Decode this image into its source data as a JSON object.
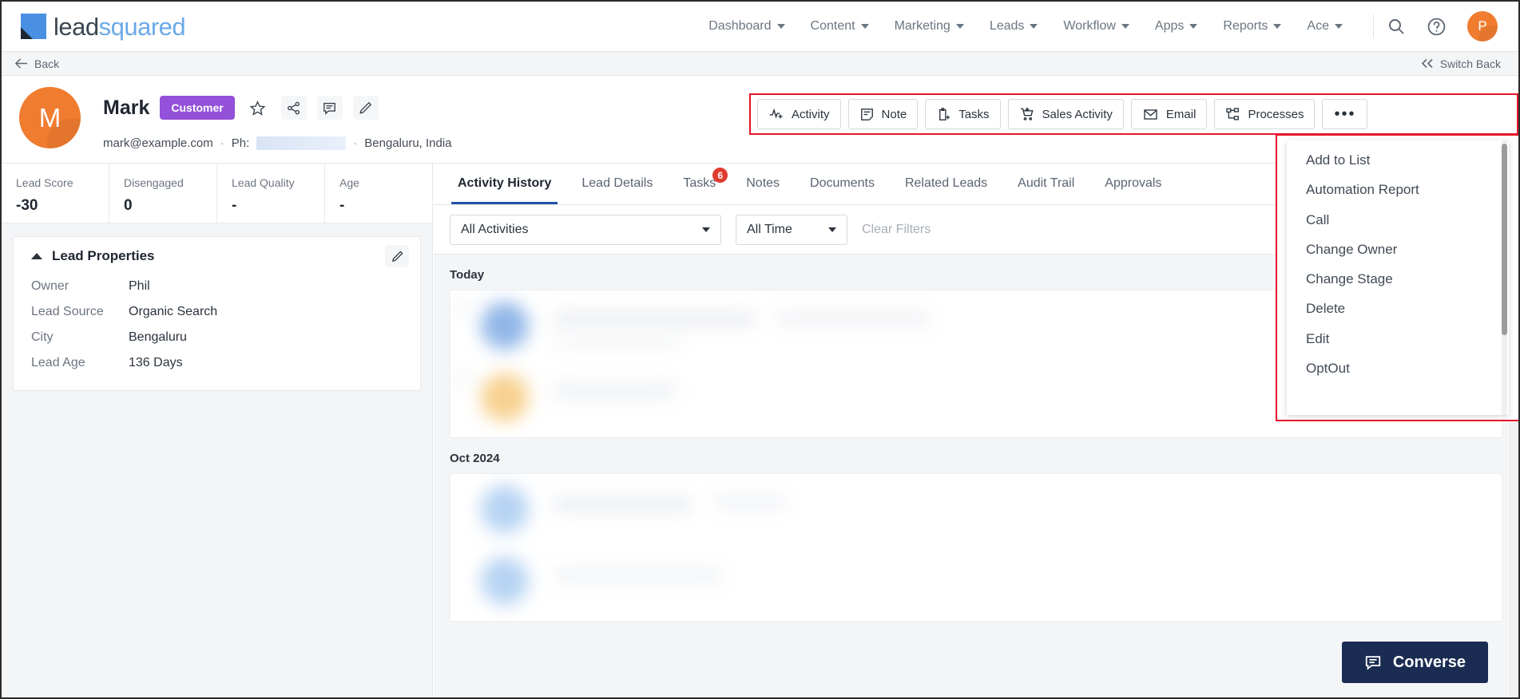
{
  "topnav": {
    "brand": {
      "part1": "lead",
      "part2": "squared"
    },
    "items": [
      {
        "label": "Dashboard",
        "icon": "chevron-down-icon"
      },
      {
        "label": "Content",
        "icon": "chevron-down-icon"
      },
      {
        "label": "Marketing",
        "icon": "chevron-down-icon"
      },
      {
        "label": "Leads",
        "icon": "chevron-down-icon"
      },
      {
        "label": "Workflow",
        "icon": "chevron-down-icon"
      },
      {
        "label": "Apps",
        "icon": "chevron-down-icon"
      },
      {
        "label": "Reports",
        "icon": "chevron-down-icon"
      },
      {
        "label": "Ace",
        "icon": "chevron-down-icon"
      }
    ],
    "icons": {
      "search": "search-icon",
      "help": "help-circle-icon"
    },
    "avatar_initial": "P",
    "avatar_color": "#f07c30"
  },
  "backbar": {
    "back_label": "Back",
    "back_icon": "arrow-left-icon",
    "switch_label": "Switch Back",
    "switch_icon": "chevrons-left-icon"
  },
  "lead": {
    "avatar_initial": "M",
    "name": "Mark",
    "badge": "Customer",
    "badge_color": "#9350d8",
    "email": "mark@example.com",
    "phone_label": "Ph:",
    "phone_value": "",
    "location": "Bengaluru, India",
    "header_icons": [
      {
        "name": "star-icon"
      },
      {
        "name": "share-icon"
      },
      {
        "name": "comment-icon"
      },
      {
        "name": "edit-pencil-icon"
      }
    ]
  },
  "action_bar": {
    "highlight_color": "#e8152a",
    "buttons": [
      {
        "label": "Activity",
        "icon": "activity-add-icon"
      },
      {
        "label": "Note",
        "icon": "note-icon"
      },
      {
        "label": "Tasks",
        "icon": "clipboard-add-icon"
      },
      {
        "label": "Sales Activity",
        "icon": "cart-add-icon"
      },
      {
        "label": "Email",
        "icon": "envelope-icon"
      },
      {
        "label": "Processes",
        "icon": "process-nodes-icon"
      }
    ],
    "more_label": "•••"
  },
  "dropdown": {
    "highlight_color": "#e8152a",
    "items": [
      "Add to List",
      "Automation Report",
      "Call",
      "Change Owner",
      "Change Stage",
      "Delete",
      "Edit",
      "OptOut"
    ]
  },
  "stats": [
    {
      "label": "Lead Score",
      "value": "-30"
    },
    {
      "label": "Disengaged",
      "value": "0"
    },
    {
      "label": "Lead Quality",
      "value": "-"
    },
    {
      "label": "Age",
      "value": "-"
    }
  ],
  "lead_properties": {
    "title": "Lead Properties",
    "collapse_icon": "chevron-up-icon",
    "edit_icon": "edit-pencil-icon",
    "rows": [
      {
        "key": "Owner",
        "value": "Phil"
      },
      {
        "key": "Lead Source",
        "value": "Organic Search"
      },
      {
        "key": "City",
        "value": "Bengaluru"
      },
      {
        "key": "Lead Age",
        "value": "136 Days"
      }
    ]
  },
  "tabs": [
    {
      "label": "Activity History",
      "active": true,
      "badge": ""
    },
    {
      "label": "Lead Details",
      "active": false,
      "badge": ""
    },
    {
      "label": "Tasks",
      "active": false,
      "badge": "6"
    },
    {
      "label": "Notes",
      "active": false,
      "badge": ""
    },
    {
      "label": "Documents",
      "active": false,
      "badge": ""
    },
    {
      "label": "Related Leads",
      "active": false,
      "badge": ""
    },
    {
      "label": "Audit Trail",
      "active": false,
      "badge": ""
    },
    {
      "label": "Approvals",
      "active": false,
      "badge": ""
    }
  ],
  "filters": {
    "activity_select": "All Activities",
    "time_select": "All Time",
    "clear_label": "Clear Filters"
  },
  "timeline": {
    "groups": [
      {
        "label": "Today"
      },
      {
        "label": "Oct 2024"
      }
    ]
  },
  "converse": {
    "label": "Converse",
    "icon": "chat-icon",
    "color": "#1b2c52"
  }
}
